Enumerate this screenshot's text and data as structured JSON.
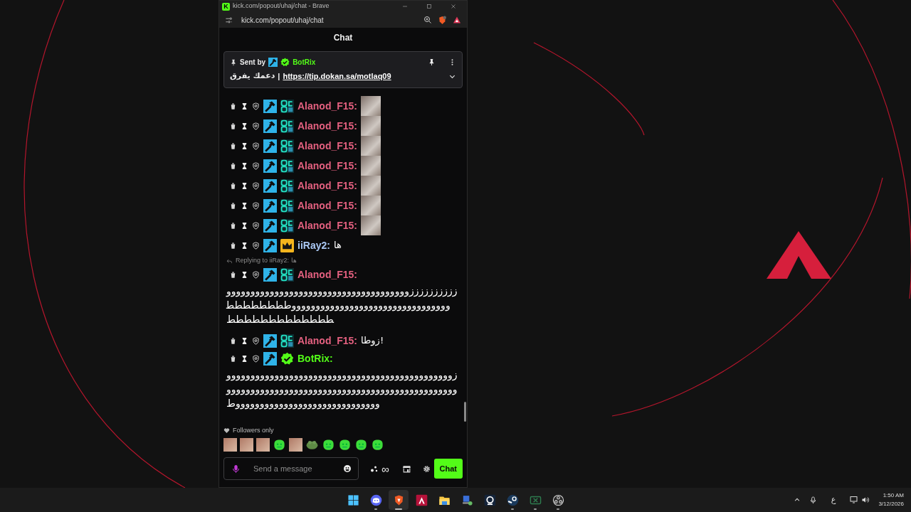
{
  "window": {
    "icon_letter": "K",
    "title": "kick.com/popout/uhaj/chat - Brave"
  },
  "address_bar": {
    "url": "kick.com/popout/uhaj/chat"
  },
  "chat": {
    "title": "Chat",
    "pinned": {
      "label": "Sent by",
      "badges": [
        {
          "kind": "moderator"
        },
        {
          "kind": "verified"
        }
      ],
      "username": "BotRix",
      "color": "#53fc18",
      "text": "دعمك يفرق",
      "separator": "|",
      "link": "https://tip.dokan.sa/motlaq09"
    },
    "messages": [
      {
        "kind": "emote",
        "username": "Alanod_F15:",
        "color": "#e3607f",
        "badges": [
          {
            "kind": "moderator"
          },
          {
            "kind": "og"
          }
        ]
      },
      {
        "kind": "emote",
        "username": "Alanod_F15:",
        "color": "#e3607f",
        "badges": [
          {
            "kind": "moderator"
          },
          {
            "kind": "og"
          }
        ]
      },
      {
        "kind": "emote",
        "username": "Alanod_F15:",
        "color": "#e3607f",
        "badges": [
          {
            "kind": "moderator"
          },
          {
            "kind": "og"
          }
        ]
      },
      {
        "kind": "emote",
        "username": "Alanod_F15:",
        "color": "#e3607f",
        "badges": [
          {
            "kind": "moderator"
          },
          {
            "kind": "og"
          }
        ]
      },
      {
        "kind": "emote",
        "username": "Alanod_F15:",
        "color": "#e3607f",
        "badges": [
          {
            "kind": "moderator"
          },
          {
            "kind": "og"
          }
        ]
      },
      {
        "kind": "emote",
        "username": "Alanod_F15:",
        "color": "#e3607f",
        "badges": [
          {
            "kind": "moderator"
          },
          {
            "kind": "og"
          }
        ]
      },
      {
        "kind": "emote",
        "username": "Alanod_F15:",
        "color": "#e3607f",
        "badges": [
          {
            "kind": "moderator"
          },
          {
            "kind": "og"
          }
        ]
      },
      {
        "kind": "text",
        "username": "iiRay2:",
        "color": "#a9c7f2",
        "badges": [
          {
            "kind": "moderator"
          },
          {
            "kind": "crown"
          }
        ],
        "text": "ها"
      },
      {
        "kind": "long",
        "reply": "Replying to iiRay2: ها",
        "username": "Alanod_F15:",
        "color": "#e3607f",
        "badges": [
          {
            "kind": "moderator"
          },
          {
            "kind": "og"
          }
        ],
        "text": "ززززززززززوووووووووووووووووووووووووووووووووووووووووووووووووووووووووووووووووووووووططططططططططططططططططططط"
      },
      {
        "kind": "text",
        "username": "Alanod_F15:",
        "color": "#e3607f",
        "badges": [
          {
            "kind": "moderator"
          },
          {
            "kind": "og"
          }
        ],
        "text": "زوطا!"
      },
      {
        "kind": "long",
        "username": "BotRix:",
        "color": "#53fc18",
        "badges": [
          {
            "kind": "moderator"
          },
          {
            "kind": "verified"
          }
        ],
        "text": "زوووووووووووووووووووووووووووووووووووووووووووووووووووووووووووووووووووووووووووووووووووووووووووووووووووووووووووووووووووووووووووووط"
      }
    ],
    "mode": "Followers only",
    "emotes": [
      {
        "kind": "photo"
      },
      {
        "kind": "photo"
      },
      {
        "kind": "photo"
      },
      {
        "kind": "blob"
      },
      {
        "kind": "photo"
      },
      {
        "kind": "frog"
      },
      {
        "kind": "blob"
      },
      {
        "kind": "blob"
      },
      {
        "kind": "blob"
      },
      {
        "kind": "blob"
      }
    ],
    "input": {
      "placeholder": "Send a message"
    },
    "chatters_symbol": "∞",
    "send_button": "Chat"
  },
  "taskbar": [
    {
      "kind": "start",
      "running": false,
      "selected": false
    },
    {
      "kind": "discord",
      "running": true,
      "selected": false
    },
    {
      "kind": "brave",
      "running": true,
      "selected": true
    },
    {
      "kind": "peak",
      "running": false,
      "selected": false
    },
    {
      "kind": "folder",
      "running": false,
      "selected": false
    },
    {
      "kind": "computer",
      "running": false,
      "selected": false
    },
    {
      "kind": "webcam",
      "running": false,
      "selected": false
    },
    {
      "kind": "steam",
      "running": true,
      "selected": false
    },
    {
      "kind": "crossbox",
      "running": true,
      "selected": false
    },
    {
      "kind": "aperture",
      "running": true,
      "selected": false
    }
  ],
  "tray": {
    "language": "ع",
    "time": "1:50 AM",
    "date": "3/12/2026"
  }
}
